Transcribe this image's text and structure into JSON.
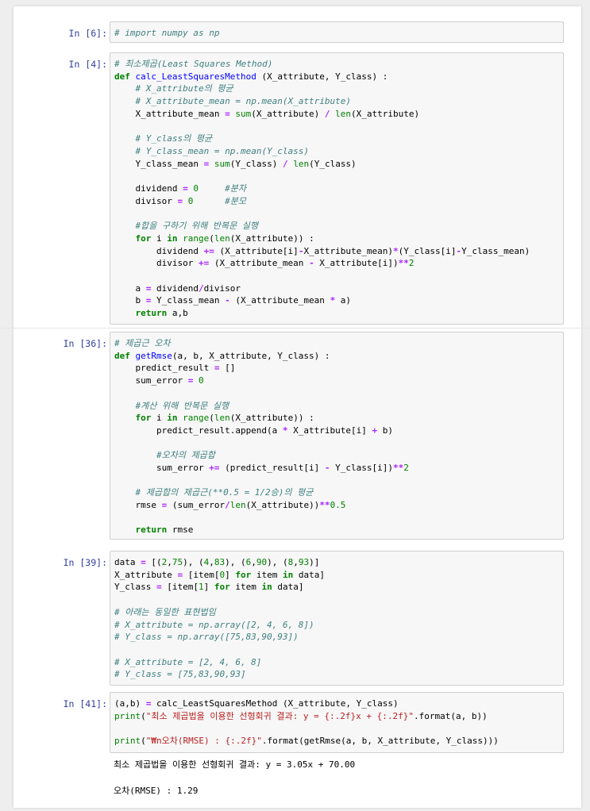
{
  "cells": [
    {
      "prompt": "In [6]:",
      "lines": [
        [
          [
            "cm",
            "# import numpy as np"
          ]
        ]
      ]
    },
    {
      "prompt": "In [4]:",
      "lines": [
        [
          [
            "cm",
            "# 최소제곱(Least Squares Method)"
          ]
        ],
        [
          [
            "kw",
            "def"
          ],
          [
            "pl",
            " "
          ],
          [
            "fn",
            "calc_LeastSquaresMethod"
          ],
          [
            "pl",
            " (X_attribute, Y_class) :"
          ]
        ],
        [
          [
            "pl",
            "    "
          ],
          [
            "cm",
            "# X_attribute의 평균"
          ]
        ],
        [
          [
            "pl",
            "    "
          ],
          [
            "cm",
            "# X_attribute_mean = np.mean(X_attribute)"
          ]
        ],
        [
          [
            "pl",
            "    X_attribute_mean "
          ],
          [
            "op",
            "="
          ],
          [
            "pl",
            " "
          ],
          [
            "bi",
            "sum"
          ],
          [
            "pl",
            "(X_attribute) "
          ],
          [
            "op",
            "/"
          ],
          [
            "pl",
            " "
          ],
          [
            "bi",
            "len"
          ],
          [
            "pl",
            "(X_attribute)"
          ]
        ],
        [
          [
            "pl",
            ""
          ]
        ],
        [
          [
            "pl",
            "    "
          ],
          [
            "cm",
            "# Y_class의 평균"
          ]
        ],
        [
          [
            "pl",
            "    "
          ],
          [
            "cm",
            "# Y_class_mean = np.mean(Y_class)"
          ]
        ],
        [
          [
            "pl",
            "    Y_class_mean "
          ],
          [
            "op",
            "="
          ],
          [
            "pl",
            " "
          ],
          [
            "bi",
            "sum"
          ],
          [
            "pl",
            "(Y_class) "
          ],
          [
            "op",
            "/"
          ],
          [
            "pl",
            " "
          ],
          [
            "bi",
            "len"
          ],
          [
            "pl",
            "(Y_class)"
          ]
        ],
        [
          [
            "pl",
            ""
          ]
        ],
        [
          [
            "pl",
            "    dividend "
          ],
          [
            "op",
            "="
          ],
          [
            "pl",
            " "
          ],
          [
            "num",
            "0"
          ],
          [
            "pl",
            "     "
          ],
          [
            "cm",
            "#분자"
          ]
        ],
        [
          [
            "pl",
            "    divisor "
          ],
          [
            "op",
            "="
          ],
          [
            "pl",
            " "
          ],
          [
            "num",
            "0"
          ],
          [
            "pl",
            "      "
          ],
          [
            "cm",
            "#분모"
          ]
        ],
        [
          [
            "pl",
            ""
          ]
        ],
        [
          [
            "pl",
            "    "
          ],
          [
            "cm",
            "#합을 구하기 위해 반복문 실행"
          ]
        ],
        [
          [
            "pl",
            "    "
          ],
          [
            "kw",
            "for"
          ],
          [
            "pl",
            " i "
          ],
          [
            "kw",
            "in"
          ],
          [
            "pl",
            " "
          ],
          [
            "bi",
            "range"
          ],
          [
            "pl",
            "("
          ],
          [
            "bi",
            "len"
          ],
          [
            "pl",
            "(X_attribute)) :"
          ]
        ],
        [
          [
            "pl",
            "        dividend "
          ],
          [
            "op",
            "+="
          ],
          [
            "pl",
            " (X_attribute[i]"
          ],
          [
            "op",
            "-"
          ],
          [
            "pl",
            "X_attribute_mean)"
          ],
          [
            "op",
            "*"
          ],
          [
            "pl",
            "(Y_class[i]"
          ],
          [
            "op",
            "-"
          ],
          [
            "pl",
            "Y_class_mean)"
          ]
        ],
        [
          [
            "pl",
            "        divisor "
          ],
          [
            "op",
            "+="
          ],
          [
            "pl",
            " (X_attribute_mean "
          ],
          [
            "op",
            "-"
          ],
          [
            "pl",
            " X_attribute[i])"
          ],
          [
            "op",
            "**"
          ],
          [
            "num",
            "2"
          ]
        ],
        [
          [
            "pl",
            ""
          ]
        ],
        [
          [
            "pl",
            "    a "
          ],
          [
            "op",
            "="
          ],
          [
            "pl",
            " dividend"
          ],
          [
            "op",
            "/"
          ],
          [
            "pl",
            "divisor"
          ]
        ],
        [
          [
            "pl",
            "    b "
          ],
          [
            "op",
            "="
          ],
          [
            "pl",
            " Y_class_mean "
          ],
          [
            "op",
            "-"
          ],
          [
            "pl",
            " (X_attribute_mean "
          ],
          [
            "op",
            "*"
          ],
          [
            "pl",
            " a)"
          ]
        ],
        [
          [
            "pl",
            "    "
          ],
          [
            "kw",
            "return"
          ],
          [
            "pl",
            " a,b"
          ]
        ]
      ]
    },
    {
      "prompt": "In [36]:",
      "lines": [
        [
          [
            "cm",
            "# 제곱근 오차"
          ]
        ],
        [
          [
            "kw",
            "def"
          ],
          [
            "pl",
            " "
          ],
          [
            "fn",
            "getRmse"
          ],
          [
            "pl",
            "(a, b, X_attribute, Y_class) :"
          ]
        ],
        [
          [
            "pl",
            "    predict_result "
          ],
          [
            "op",
            "="
          ],
          [
            "pl",
            " []"
          ]
        ],
        [
          [
            "pl",
            "    sum_error "
          ],
          [
            "op",
            "="
          ],
          [
            "pl",
            " "
          ],
          [
            "num",
            "0"
          ]
        ],
        [
          [
            "pl",
            ""
          ]
        ],
        [
          [
            "pl",
            "    "
          ],
          [
            "cm",
            "#계산 위해 반복문 실행"
          ]
        ],
        [
          [
            "pl",
            "    "
          ],
          [
            "kw",
            "for"
          ],
          [
            "pl",
            " i "
          ],
          [
            "kw",
            "in"
          ],
          [
            "pl",
            " "
          ],
          [
            "bi",
            "range"
          ],
          [
            "pl",
            "("
          ],
          [
            "bi",
            "len"
          ],
          [
            "pl",
            "(X_attribute)) :"
          ]
        ],
        [
          [
            "pl",
            "        predict_result.append(a "
          ],
          [
            "op",
            "*"
          ],
          [
            "pl",
            " X_attribute[i] "
          ],
          [
            "op",
            "+"
          ],
          [
            "pl",
            " b)"
          ]
        ],
        [
          [
            "pl",
            ""
          ]
        ],
        [
          [
            "pl",
            "        "
          ],
          [
            "cm",
            "#오차의 제곱합"
          ]
        ],
        [
          [
            "pl",
            "        sum_error "
          ],
          [
            "op",
            "+="
          ],
          [
            "pl",
            " (predict_result[i] "
          ],
          [
            "op",
            "-"
          ],
          [
            "pl",
            " Y_class[i])"
          ],
          [
            "op",
            "**"
          ],
          [
            "num",
            "2"
          ]
        ],
        [
          [
            "pl",
            ""
          ]
        ],
        [
          [
            "pl",
            "    "
          ],
          [
            "cm",
            "# 제곱합의 제곱근(**0.5 = 1/2승)의 평균"
          ]
        ],
        [
          [
            "pl",
            "    rmse "
          ],
          [
            "op",
            "="
          ],
          [
            "pl",
            " (sum_error"
          ],
          [
            "op",
            "/"
          ],
          [
            "bi",
            "len"
          ],
          [
            "pl",
            "(X_attribute))"
          ],
          [
            "op",
            "**"
          ],
          [
            "num",
            "0.5"
          ]
        ],
        [
          [
            "pl",
            ""
          ]
        ],
        [
          [
            "pl",
            "    "
          ],
          [
            "kw",
            "return"
          ],
          [
            "pl",
            " rmse"
          ]
        ]
      ]
    },
    {
      "prompt": "In [39]:",
      "lines": [
        [
          [
            "pl",
            "data "
          ],
          [
            "op",
            "="
          ],
          [
            "pl",
            " [("
          ],
          [
            "num",
            "2"
          ],
          [
            "pl",
            ","
          ],
          [
            "num",
            "75"
          ],
          [
            "pl",
            "), ("
          ],
          [
            "num",
            "4"
          ],
          [
            "pl",
            ","
          ],
          [
            "num",
            "83"
          ],
          [
            "pl",
            "), ("
          ],
          [
            "num",
            "6"
          ],
          [
            "pl",
            ","
          ],
          [
            "num",
            "90"
          ],
          [
            "pl",
            "), ("
          ],
          [
            "num",
            "8"
          ],
          [
            "pl",
            ","
          ],
          [
            "num",
            "93"
          ],
          [
            "pl",
            ")]"
          ]
        ],
        [
          [
            "pl",
            "X_attribute "
          ],
          [
            "op",
            "="
          ],
          [
            "pl",
            " [item["
          ],
          [
            "num",
            "0"
          ],
          [
            "pl",
            "] "
          ],
          [
            "kw",
            "for"
          ],
          [
            "pl",
            " item "
          ],
          [
            "kw",
            "in"
          ],
          [
            "pl",
            " data]"
          ]
        ],
        [
          [
            "pl",
            "Y_class "
          ],
          [
            "op",
            "="
          ],
          [
            "pl",
            " [item["
          ],
          [
            "num",
            "1"
          ],
          [
            "pl",
            "] "
          ],
          [
            "kw",
            "for"
          ],
          [
            "pl",
            " item "
          ],
          [
            "kw",
            "in"
          ],
          [
            "pl",
            " data]"
          ]
        ],
        [
          [
            "pl",
            ""
          ]
        ],
        [
          [
            "cm",
            "# 아래는 동일한 표현법임"
          ]
        ],
        [
          [
            "cm",
            "# X_attribute = np.array([2, 4, 6, 8])"
          ]
        ],
        [
          [
            "cm",
            "# Y_class = np.array([75,83,90,93])"
          ]
        ],
        [
          [
            "pl",
            ""
          ]
        ],
        [
          [
            "cm",
            "# X_attribute = [2, 4, 6, 8]"
          ]
        ],
        [
          [
            "cm",
            "# Y_class = [75,83,90,93]"
          ]
        ]
      ]
    },
    {
      "prompt": "In [41]:",
      "lines": [
        [
          [
            "pl",
            "(a,b) "
          ],
          [
            "op",
            "="
          ],
          [
            "pl",
            " calc_LeastSquaresMethod (X_attribute, Y_class)"
          ]
        ],
        [
          [
            "bi",
            "print"
          ],
          [
            "pl",
            "("
          ],
          [
            "str",
            "\"최소 제곱법을 이용한 선형회귀 결과: y = {:.2f}x + {:.2f}\""
          ],
          [
            "pl",
            ".format(a, b))"
          ]
        ],
        [
          [
            "pl",
            ""
          ]
        ],
        [
          [
            "bi",
            "print"
          ],
          [
            "pl",
            "("
          ],
          [
            "str",
            "\"₩n오차(RMSE) : {:.2f}\""
          ],
          [
            "pl",
            ".format(getRmse(a, b, X_attribute, Y_class)))"
          ]
        ]
      ],
      "outputs": [
        "최소 제곱법을 이용한 선형회귀 결과: y = 3.05x + 70.00",
        "오차(RMSE) : 1.29"
      ]
    }
  ]
}
